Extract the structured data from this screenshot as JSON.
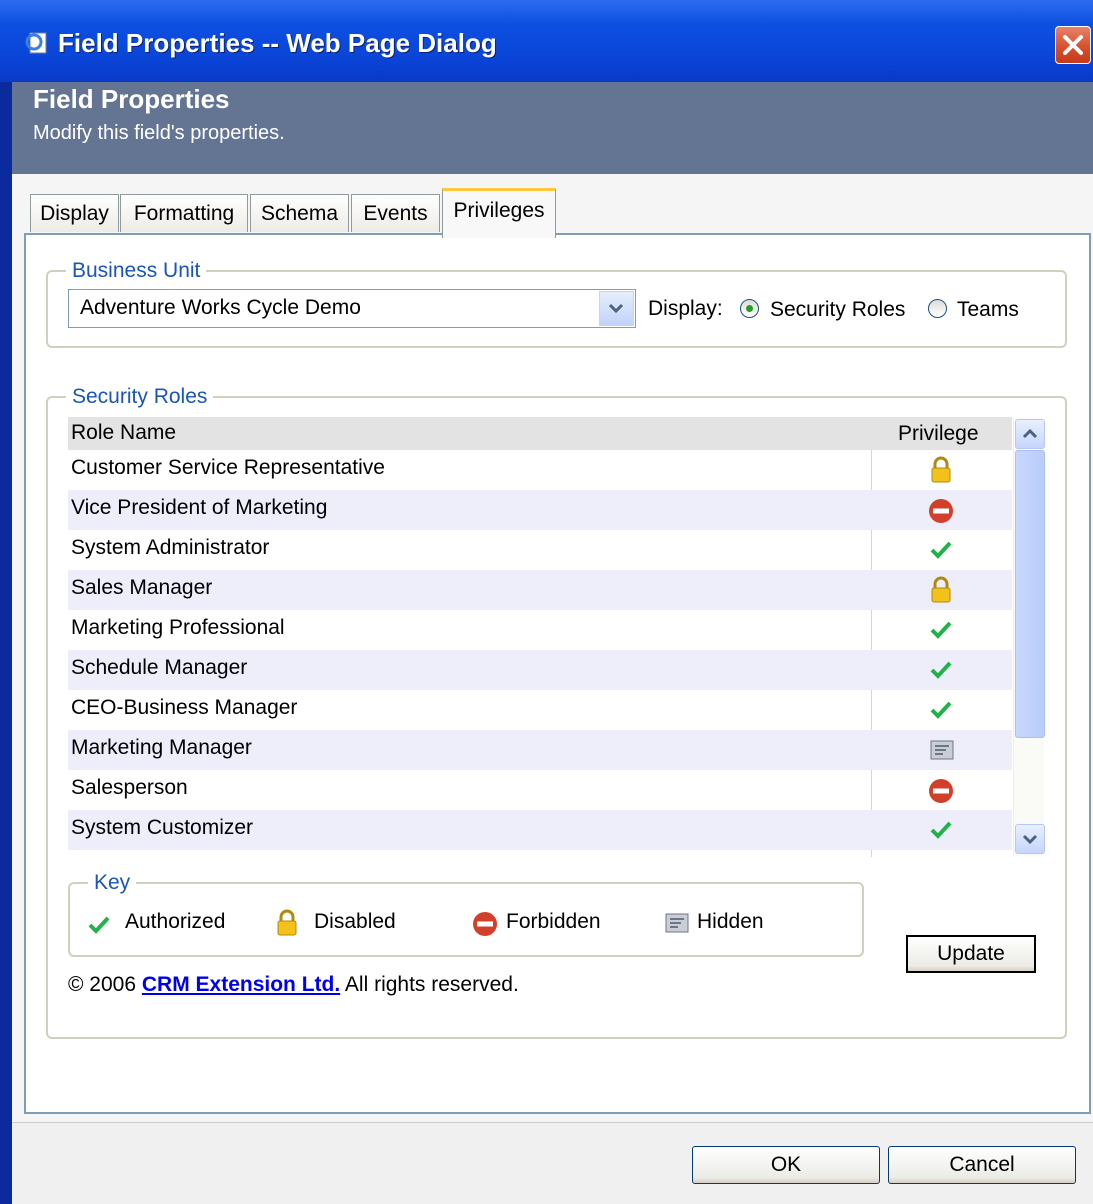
{
  "window": {
    "title": "Field Properties -- Web Page Dialog"
  },
  "header": {
    "title": "Field Properties",
    "subtitle": "Modify this field's properties."
  },
  "tabs": [
    {
      "label": "Display"
    },
    {
      "label": "Formatting"
    },
    {
      "label": "Schema"
    },
    {
      "label": "Events"
    },
    {
      "label": "Privileges",
      "active": true
    }
  ],
  "business_unit": {
    "legend": "Business Unit",
    "selected": "Adventure Works Cycle Demo",
    "display_label": "Display:",
    "options": [
      {
        "label": "Security Roles",
        "checked": true
      },
      {
        "label": "Teams",
        "checked": false
      }
    ]
  },
  "security_roles": {
    "legend": "Security Roles",
    "columns": [
      "Role Name",
      "Privilege"
    ],
    "rows": [
      {
        "name": "Customer Service Representative",
        "privilege": "lock-icon"
      },
      {
        "name": "Vice President of Marketing",
        "privilege": "forbidden-icon"
      },
      {
        "name": "System Administrator",
        "privilege": "check-icon"
      },
      {
        "name": "Sales Manager",
        "privilege": "lock-icon"
      },
      {
        "name": "Marketing Professional",
        "privilege": "check-icon"
      },
      {
        "name": "Schedule Manager",
        "privilege": "check-icon"
      },
      {
        "name": "CEO-Business Manager",
        "privilege": "check-icon"
      },
      {
        "name": "Marketing Manager",
        "privilege": "hidden-icon"
      },
      {
        "name": "Salesperson",
        "privilege": "forbidden-icon"
      },
      {
        "name": "System Customizer",
        "privilege": "check-icon"
      }
    ]
  },
  "key": {
    "legend": "Key",
    "items": [
      {
        "label": "Authorized",
        "icon": "check-icon"
      },
      {
        "label": "Disabled",
        "icon": "lock-icon"
      },
      {
        "label": "Forbidden",
        "icon": "forbidden-icon"
      },
      {
        "label": "Hidden",
        "icon": "hidden-icon"
      }
    ]
  },
  "update_button": "Update",
  "footer": {
    "copyright": "© 2006",
    "link_text": "CRM Extension Ltd.",
    "rights": "All rights reserved."
  },
  "buttons": {
    "ok": "OK",
    "cancel": "Cancel"
  },
  "colors": {
    "accent": "#0a45d8",
    "header": "#647593",
    "legend": "#1a55b8",
    "check": "#21b24a",
    "forbidden": "#d23f2b",
    "lock": "#f2c21a"
  }
}
